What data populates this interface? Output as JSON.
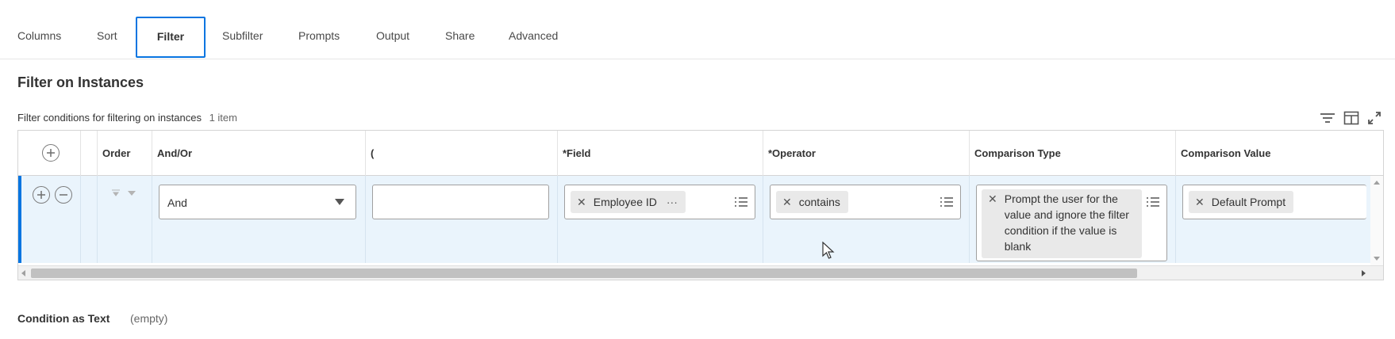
{
  "tabs": [
    {
      "label": "Columns",
      "active": false
    },
    {
      "label": "Sort",
      "active": false
    },
    {
      "label": "Filter",
      "active": true
    },
    {
      "label": "Subfilter",
      "active": false
    },
    {
      "label": "Prompts",
      "active": false
    },
    {
      "label": "Output",
      "active": false
    },
    {
      "label": "Share",
      "active": false
    },
    {
      "label": "Advanced",
      "active": false
    }
  ],
  "section_title": "Filter on Instances",
  "grid": {
    "caption": "Filter conditions for filtering on instances",
    "item_count": "1 item",
    "toolbar_icons": [
      "filter-icon",
      "columns-layout-icon",
      "expand-icon"
    ],
    "columns": [
      "Order",
      "And/Or",
      "(",
      "*Field",
      "*Operator",
      "Comparison Type",
      "Comparison Value"
    ],
    "rows": [
      {
        "and_or": "And",
        "paren": "",
        "field": "Employee ID",
        "operator": "contains",
        "comparison_type": "Prompt the user for the value and ignore the filter condition if the value is blank",
        "comparison_value": "Default Prompt"
      }
    ]
  },
  "condition": {
    "label": "Condition as Text",
    "value": "(empty)"
  },
  "colors": {
    "accent": "#0875e1",
    "row_selected_bg": "#eaf4fc",
    "pill_bg": "#e9e9e9"
  }
}
